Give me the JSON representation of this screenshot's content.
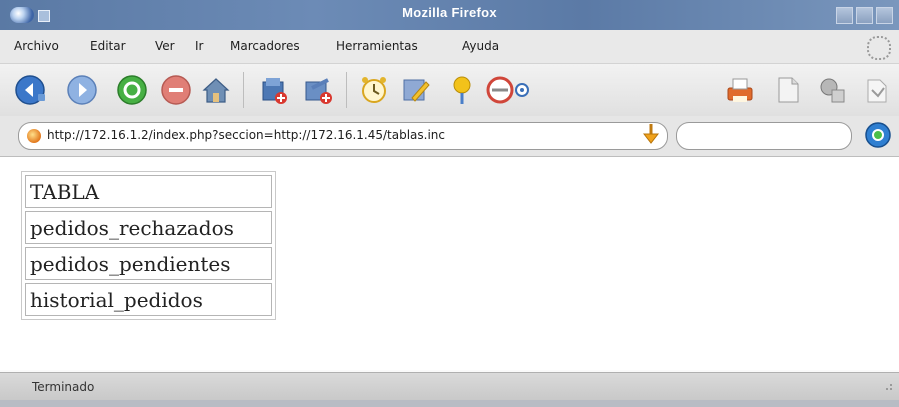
{
  "window": {
    "title": "Mozilla Firefox"
  },
  "menu": {
    "items": [
      {
        "label": "Archivo"
      },
      {
        "label": "Editar"
      },
      {
        "label": "Ver"
      },
      {
        "label": "Ir"
      },
      {
        "label": "Marcadores"
      },
      {
        "label": "Herramientas"
      },
      {
        "label": "Ayuda"
      }
    ]
  },
  "toolbar": {
    "buttons": [
      {
        "icon": "back-icon"
      },
      {
        "icon": "forward-icon"
      },
      {
        "icon": "reload-icon"
      },
      {
        "icon": "stop-icon"
      },
      {
        "icon": "home-icon"
      },
      {
        "icon": "add-bookmark-icon"
      },
      {
        "icon": "add-page-icon"
      },
      {
        "icon": "history-icon"
      },
      {
        "icon": "edit-icon"
      },
      {
        "icon": "pin-icon"
      },
      {
        "icon": "mail-icon"
      },
      {
        "icon": "print-icon"
      },
      {
        "icon": "new-document-icon"
      },
      {
        "icon": "tools-icon"
      },
      {
        "icon": "extension-icon"
      }
    ]
  },
  "address": {
    "url": "http://172.16.1.2/index.php?seccion=http://172.16.1.45/tablas.inc"
  },
  "search": {
    "value": ""
  },
  "content": {
    "table": {
      "header": "TABLA",
      "rows": [
        "pedidos_rechazados",
        "pedidos_pendientes",
        "historial_pedidos"
      ]
    }
  },
  "status": {
    "text": "Terminado"
  },
  "colors": {
    "titlebar": "#5a79a4",
    "accent_blue": "#2d6fc6",
    "status_bg": "#d0d0d0"
  }
}
